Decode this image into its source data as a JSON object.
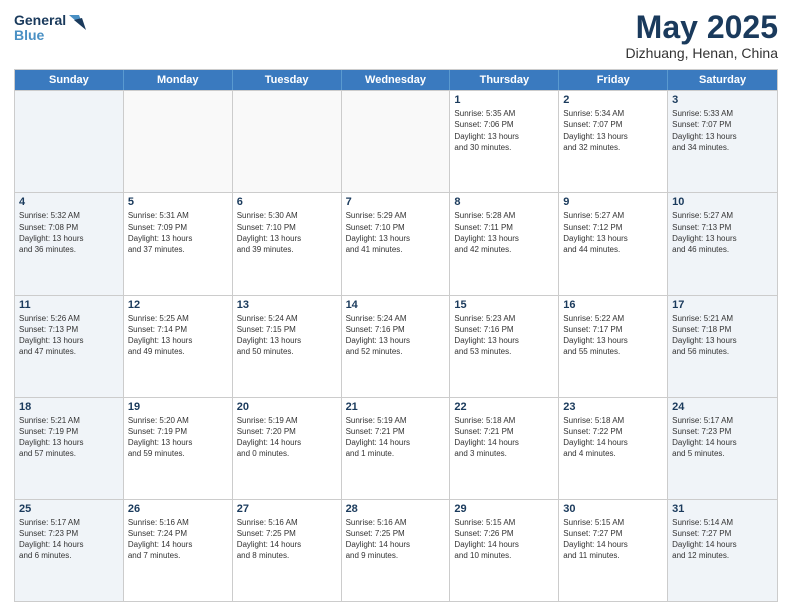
{
  "header": {
    "logo_line1": "General",
    "logo_line2": "Blue",
    "month": "May 2025",
    "location": "Dizhuang, Henan, China"
  },
  "weekdays": [
    "Sunday",
    "Monday",
    "Tuesday",
    "Wednesday",
    "Thursday",
    "Friday",
    "Saturday"
  ],
  "rows": [
    [
      {
        "day": "",
        "text": ""
      },
      {
        "day": "",
        "text": ""
      },
      {
        "day": "",
        "text": ""
      },
      {
        "day": "",
        "text": ""
      },
      {
        "day": "1",
        "text": "Sunrise: 5:35 AM\nSunset: 7:06 PM\nDaylight: 13 hours\nand 30 minutes."
      },
      {
        "day": "2",
        "text": "Sunrise: 5:34 AM\nSunset: 7:07 PM\nDaylight: 13 hours\nand 32 minutes."
      },
      {
        "day": "3",
        "text": "Sunrise: 5:33 AM\nSunset: 7:07 PM\nDaylight: 13 hours\nand 34 minutes."
      }
    ],
    [
      {
        "day": "4",
        "text": "Sunrise: 5:32 AM\nSunset: 7:08 PM\nDaylight: 13 hours\nand 36 minutes."
      },
      {
        "day": "5",
        "text": "Sunrise: 5:31 AM\nSunset: 7:09 PM\nDaylight: 13 hours\nand 37 minutes."
      },
      {
        "day": "6",
        "text": "Sunrise: 5:30 AM\nSunset: 7:10 PM\nDaylight: 13 hours\nand 39 minutes."
      },
      {
        "day": "7",
        "text": "Sunrise: 5:29 AM\nSunset: 7:10 PM\nDaylight: 13 hours\nand 41 minutes."
      },
      {
        "day": "8",
        "text": "Sunrise: 5:28 AM\nSunset: 7:11 PM\nDaylight: 13 hours\nand 42 minutes."
      },
      {
        "day": "9",
        "text": "Sunrise: 5:27 AM\nSunset: 7:12 PM\nDaylight: 13 hours\nand 44 minutes."
      },
      {
        "day": "10",
        "text": "Sunrise: 5:27 AM\nSunset: 7:13 PM\nDaylight: 13 hours\nand 46 minutes."
      }
    ],
    [
      {
        "day": "11",
        "text": "Sunrise: 5:26 AM\nSunset: 7:13 PM\nDaylight: 13 hours\nand 47 minutes."
      },
      {
        "day": "12",
        "text": "Sunrise: 5:25 AM\nSunset: 7:14 PM\nDaylight: 13 hours\nand 49 minutes."
      },
      {
        "day": "13",
        "text": "Sunrise: 5:24 AM\nSunset: 7:15 PM\nDaylight: 13 hours\nand 50 minutes."
      },
      {
        "day": "14",
        "text": "Sunrise: 5:24 AM\nSunset: 7:16 PM\nDaylight: 13 hours\nand 52 minutes."
      },
      {
        "day": "15",
        "text": "Sunrise: 5:23 AM\nSunset: 7:16 PM\nDaylight: 13 hours\nand 53 minutes."
      },
      {
        "day": "16",
        "text": "Sunrise: 5:22 AM\nSunset: 7:17 PM\nDaylight: 13 hours\nand 55 minutes."
      },
      {
        "day": "17",
        "text": "Sunrise: 5:21 AM\nSunset: 7:18 PM\nDaylight: 13 hours\nand 56 minutes."
      }
    ],
    [
      {
        "day": "18",
        "text": "Sunrise: 5:21 AM\nSunset: 7:19 PM\nDaylight: 13 hours\nand 57 minutes."
      },
      {
        "day": "19",
        "text": "Sunrise: 5:20 AM\nSunset: 7:19 PM\nDaylight: 13 hours\nand 59 minutes."
      },
      {
        "day": "20",
        "text": "Sunrise: 5:19 AM\nSunset: 7:20 PM\nDaylight: 14 hours\nand 0 minutes."
      },
      {
        "day": "21",
        "text": "Sunrise: 5:19 AM\nSunset: 7:21 PM\nDaylight: 14 hours\nand 1 minute."
      },
      {
        "day": "22",
        "text": "Sunrise: 5:18 AM\nSunset: 7:21 PM\nDaylight: 14 hours\nand 3 minutes."
      },
      {
        "day": "23",
        "text": "Sunrise: 5:18 AM\nSunset: 7:22 PM\nDaylight: 14 hours\nand 4 minutes."
      },
      {
        "day": "24",
        "text": "Sunrise: 5:17 AM\nSunset: 7:23 PM\nDaylight: 14 hours\nand 5 minutes."
      }
    ],
    [
      {
        "day": "25",
        "text": "Sunrise: 5:17 AM\nSunset: 7:23 PM\nDaylight: 14 hours\nand 6 minutes."
      },
      {
        "day": "26",
        "text": "Sunrise: 5:16 AM\nSunset: 7:24 PM\nDaylight: 14 hours\nand 7 minutes."
      },
      {
        "day": "27",
        "text": "Sunrise: 5:16 AM\nSunset: 7:25 PM\nDaylight: 14 hours\nand 8 minutes."
      },
      {
        "day": "28",
        "text": "Sunrise: 5:16 AM\nSunset: 7:25 PM\nDaylight: 14 hours\nand 9 minutes."
      },
      {
        "day": "29",
        "text": "Sunrise: 5:15 AM\nSunset: 7:26 PM\nDaylight: 14 hours\nand 10 minutes."
      },
      {
        "day": "30",
        "text": "Sunrise: 5:15 AM\nSunset: 7:27 PM\nDaylight: 14 hours\nand 11 minutes."
      },
      {
        "day": "31",
        "text": "Sunrise: 5:14 AM\nSunset: 7:27 PM\nDaylight: 14 hours\nand 12 minutes."
      }
    ]
  ]
}
